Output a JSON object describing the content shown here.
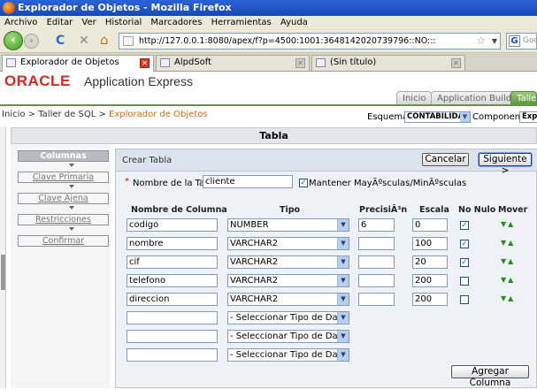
{
  "window": {
    "title": "Explorador de Objetos - Mozilla Firefox"
  },
  "menu": [
    "Archivo",
    "Editar",
    "Ver",
    "Historial",
    "Marcadores",
    "Herramientas",
    "Ayuda"
  ],
  "nav": {
    "url": "http://127.0.0.1:8080/apex/f?p=4500:1001:3648142020739796::NO:::",
    "search_placeholder": "Goo",
    "back_glyph": "‹",
    "forward_glyph": "›",
    "reload_glyph": "C",
    "stop_glyph": "✕",
    "home_glyph": "⌂"
  },
  "tabs": [
    {
      "label": "Explorador de Objetos"
    },
    {
      "label": "AlpdSoft"
    },
    {
      "label": "(Sin título)"
    }
  ],
  "header": {
    "logo": "ORACLE",
    "app_name": "Application Express",
    "apex_tabs": [
      "Inicio",
      "Application Builder",
      "Taller"
    ]
  },
  "breadcrumb": {
    "home": "Inicio",
    "sep1": " > ",
    "sql": "Taller de SQL",
    "sep2": " > ",
    "current": "Explorador de Objetos"
  },
  "context": {
    "schema_label": "Esquema",
    "schema_value": "CONTABILIDAD",
    "component_label": "Componente",
    "component_value": "Explo"
  },
  "section_title": "Tabla",
  "wizard": [
    {
      "label": "Columnas",
      "active": true
    },
    {
      "label": "Clave Primaria",
      "active": false
    },
    {
      "label": "Clave Ajena",
      "active": false
    },
    {
      "label": "Restricciones",
      "active": false
    },
    {
      "label": "Confirmar",
      "active": false
    }
  ],
  "form": {
    "title": "Crear Tabla",
    "cancel": "Cancelar",
    "next": "Siguiente >",
    "required_mark": "*",
    "table_name_label": "Nombre de la Tabla",
    "table_name_value": "cliente",
    "keep_case_label": "Mantener MayÃºsculas/MinÃºsculas",
    "keep_case_checked": true,
    "add_column": "Agregar Columna"
  },
  "columns_header": {
    "name": "Nombre de Columna",
    "type": "Tipo",
    "precision": "PrecisiÃ³n",
    "scale": "Escala",
    "not_null": "No Nulo",
    "move": "Mover"
  },
  "rows": [
    {
      "name": "codigo",
      "type": "NUMBER",
      "precision": "6",
      "scale": "0",
      "not_null": true
    },
    {
      "name": "nombre",
      "type": "VARCHAR2",
      "precision": "",
      "scale": "100",
      "not_null": true
    },
    {
      "name": "cif",
      "type": "VARCHAR2",
      "precision": "",
      "scale": "20",
      "not_null": true
    },
    {
      "name": "telefono",
      "type": "VARCHAR2",
      "precision": "",
      "scale": "200",
      "not_null": false
    },
    {
      "name": "direccion",
      "type": "VARCHAR2",
      "precision": "",
      "scale": "200",
      "not_null": false
    },
    {
      "name": "",
      "type": "- Seleccionar Tipo de Dato -",
      "precision": "",
      "scale": "",
      "not_null": false
    },
    {
      "name": "",
      "type": "- Seleccionar Tipo de Dato -",
      "precision": "",
      "scale": "",
      "not_null": false
    },
    {
      "name": "",
      "type": "- Seleccionar Tipo de Dato -",
      "precision": "",
      "scale": "",
      "not_null": false
    }
  ],
  "move_glyphs": {
    "down": "▼",
    "up": "▲"
  },
  "colors": {
    "oracle_red": "#e2231a",
    "apex_green": "#5c9a3a",
    "crumb_orange": "#e06a10",
    "firefox_blue": "#2a63d6"
  }
}
